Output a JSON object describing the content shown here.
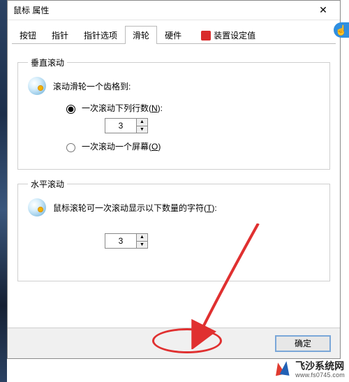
{
  "window": {
    "title": "鼠标 属性",
    "close_label": "✕"
  },
  "tabs": {
    "buttons": "按钮",
    "pointers": "指针",
    "pointer_options": "指针选项",
    "wheel": "滑轮",
    "hardware": "硬件",
    "device": "装置设定值"
  },
  "vertical": {
    "legend": "垂直滚动",
    "desc": "滚动滑轮一个齿格到:",
    "opt_lines_pre": "一次滚动下列行数(",
    "opt_lines_key": "N",
    "opt_lines_post": "):",
    "lines_value": "3",
    "opt_screen_pre": "一次滚动一个屏幕(",
    "opt_screen_key": "O",
    "opt_screen_post": ")"
  },
  "horizontal": {
    "legend": "水平滚动",
    "desc_pre": "鼠标滚轮可一次滚动显示以下数量的字符(",
    "desc_key": "T",
    "desc_post": "):",
    "chars_value": "3"
  },
  "buttons_bar": {
    "ok": "确定"
  },
  "watermark": {
    "name": "飞沙系统网",
    "url": "www.fs0745.com"
  },
  "badge": {
    "glyph": "☝"
  }
}
